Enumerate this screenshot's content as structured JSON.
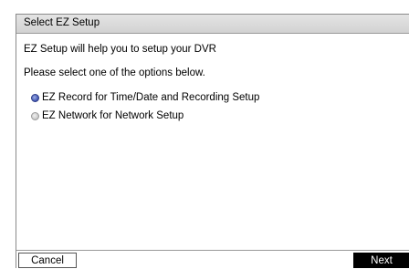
{
  "dialog": {
    "title": "Select EZ Setup",
    "intro": "EZ Setup will help you to setup your DVR",
    "prompt": "Please select one of the options below.",
    "options": [
      {
        "label": "EZ Record for Time/Date and Recording Setup",
        "selected": true
      },
      {
        "label": "EZ Network for Network Setup",
        "selected": false
      }
    ],
    "buttons": {
      "cancel_label": "Cancel",
      "next_label": "Next"
    }
  },
  "colors": {
    "title_bar": "#d8d8d8",
    "selected_radio": "#4b5fb8",
    "next_button_bg": "#000000",
    "next_button_text": "#ffffff"
  }
}
